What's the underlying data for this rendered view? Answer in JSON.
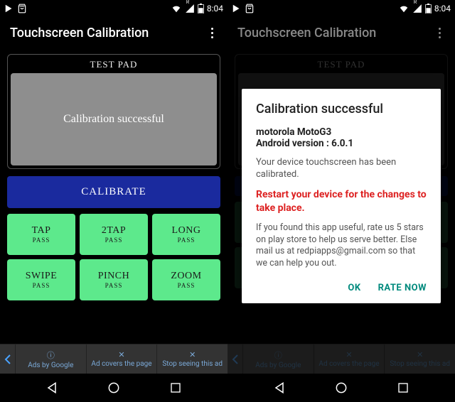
{
  "status": {
    "time": "8:04",
    "roaming": "R"
  },
  "app": {
    "title": "Touchscreen Calibration"
  },
  "testpad": {
    "label": "TEST PAD",
    "message": "Calibration successful"
  },
  "calibrate_label": "CALIBRATE",
  "tiles": [
    {
      "title": "TAP",
      "sub": "PASS"
    },
    {
      "title": "2TAP",
      "sub": "PASS"
    },
    {
      "title": "LONG",
      "sub": "PASS"
    },
    {
      "title": "SWIPE",
      "sub": "PASS"
    },
    {
      "title": "PINCH",
      "sub": "PASS"
    },
    {
      "title": "ZOOM",
      "sub": "PASS"
    }
  ],
  "ads": {
    "by": "Ads by Google",
    "covers": "Ad covers the page",
    "stop": "Stop seeing this ad"
  },
  "dialog": {
    "title": "Calibration successful",
    "device": "motorola MotoG3",
    "android_label": "Android version : ",
    "android_version": "6.0.1",
    "body": "Your device touchscreen has been calibrated.",
    "restart": "Restart your device for the changes to take place.",
    "footer": "If you found this app useful, rate us 5 stars on play store to help us serve better. Else mail us at redpiapps@gmail.com so that we can help you out.",
    "ok": "OK",
    "rate": "RATE NOW"
  }
}
